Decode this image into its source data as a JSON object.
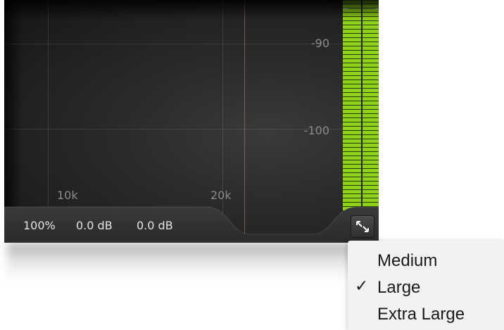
{
  "graph": {
    "db_scale": [
      "-90",
      "-100"
    ],
    "freq_scale": [
      "10k",
      "20k"
    ]
  },
  "status_bar": {
    "zoom": "100%",
    "gain_1": "0.0 dB",
    "gain_2": "0.0 dB"
  },
  "resize_button": {
    "icon": "resize-expand-icon"
  },
  "size_menu": {
    "items": [
      {
        "label": "Medium",
        "checked": false
      },
      {
        "label": "Large",
        "checked": true,
        "check_mark": "✓"
      },
      {
        "label": "Extra Large",
        "checked": false
      }
    ]
  },
  "colors": {
    "panel_bg": "#2c2c2c",
    "meter_green": "#8fd11a",
    "accent_line": "#be8c46",
    "menu_bg": "#f2f2f2"
  }
}
